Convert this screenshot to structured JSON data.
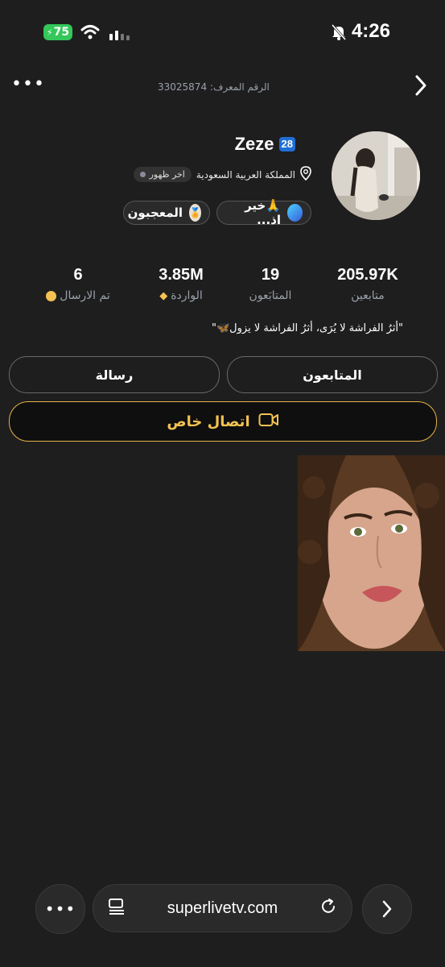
{
  "status_bar": {
    "battery": "75",
    "time": "4:26"
  },
  "header": {
    "id_label": "الرقم المعرف:",
    "id_value": "33025874"
  },
  "profile": {
    "name": "Zeze",
    "level": "28",
    "country": "المملكة العربية السعودية",
    "last_seen": "اخر ظهور",
    "chip_status": "🙏خير اذ...",
    "chip_likes": "المعجبون",
    "bio": "\"أثرُ الفراشة لا يُرَى، أثرُ الفراشة لا يزول🦋\""
  },
  "stats": [
    {
      "value": "205.97K",
      "label": "متابعين"
    },
    {
      "value": "19",
      "label": "المتابَعون"
    },
    {
      "value": "3.85M",
      "label": "الواردة"
    },
    {
      "value": "6",
      "label": "تم الارسال"
    }
  ],
  "buttons": {
    "follow": "المتابعون",
    "message": "رسالة",
    "private_call": "اتصال خاص"
  },
  "browser": {
    "url": "superlivetv.com"
  },
  "colors": {
    "accent_gold": "#f4c252",
    "level_blue": "#1f6fd6",
    "battery_green": "#34c759"
  }
}
